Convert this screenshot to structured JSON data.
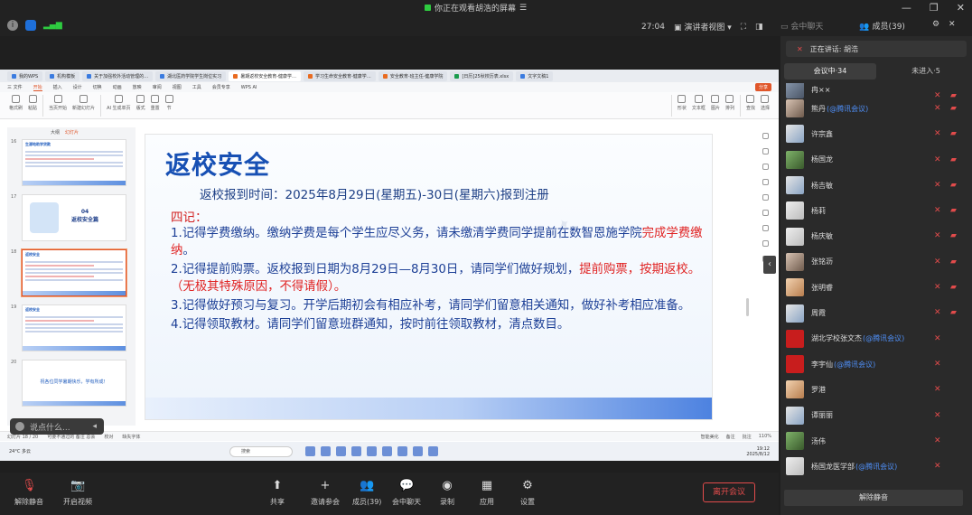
{
  "topbar": {
    "sharing_text": "你正在观看胡浩的屏幕",
    "timer": "27:04",
    "view_mode": "演讲者视图",
    "chat_tab": "会中聊天",
    "members_label": "成员(39)"
  },
  "wps": {
    "tabs": [
      {
        "label": "我的WPS",
        "kind": "home"
      },
      {
        "label": "机构模板",
        "kind": "doc"
      },
      {
        "label": "关于加强校外活动管理的…",
        "kind": "doc"
      },
      {
        "label": "湖北医药学院学生岗位实习",
        "kind": "doc"
      },
      {
        "label": "暑期返校安全教育-健康学…",
        "kind": "ppt",
        "active": true
      },
      {
        "label": "学习生命安全教育-健康学…",
        "kind": "ppt"
      },
      {
        "label": "安全教育-班主任-健康学院",
        "kind": "ppt"
      },
      {
        "label": "[日历]25秋校历表.xlsx",
        "kind": "xls"
      },
      {
        "label": "文字文稿1",
        "kind": "doc"
      }
    ],
    "menu": [
      "三 文件",
      "开始",
      "插入",
      "设计",
      "切换",
      "动画",
      "放映",
      "审阅",
      "视图",
      "工具",
      "会员专享",
      "WPS AI"
    ],
    "menu_active": "开始",
    "share_label": "分享",
    "ribbon": [
      "格式刷",
      "粘贴",
      "当页开始",
      "新建幻灯片",
      "AI 生成单页",
      "版式",
      "重置",
      "节",
      "形状",
      "文本框",
      "图片",
      "排列",
      "查找",
      "选择"
    ],
    "thumb_tabs": [
      "大纲",
      "幻灯片"
    ],
    "thumbs": [
      {
        "num": "16",
        "title": "生源地助学贷款"
      },
      {
        "num": "17",
        "title": "04 返校安全篇"
      },
      {
        "num": "18",
        "title": "返校安全"
      },
      {
        "num": "19",
        "title": "返校安全"
      },
      {
        "num": "20",
        "title": "祝各位同学暑期快乐，学有所成！"
      }
    ],
    "thumb_cover_num": "04",
    "thumb_cover_text": "返校安全篇",
    "status": {
      "slide_pos": "幻灯片 18 / 20",
      "theme": "可要不通过的 备注 总会",
      "proof": "校对",
      "font_missing": "缺失字体",
      "smart": "智能美化",
      "notes": "备注",
      "comments": "批注",
      "zoom": "110%"
    },
    "taskbar": {
      "weather": "24°C 多云",
      "search": "搜索",
      "time": "19:12",
      "date": "2025/8/12"
    }
  },
  "slide": {
    "title": "返校安全",
    "subtitle": "返校报到时间：2025年8月29日(星期五)-30日(星期六)报到注册",
    "heading": "四记：",
    "items": [
      {
        "pre": "1.记得学费缴纳。缴纳学费是每个学生应尽义务，请未缴清学费同学提前在数智恩施学院",
        "red": "完成学费缴纳",
        "post": "。",
        "red2": ""
      },
      {
        "pre": "2.记得提前购票。返校报到日期为8月29日—8月30日，请同学们做好规划，",
        "red": "提前购票，按期返校。（无极其特殊原因，不得请假）",
        "post": "。",
        "red2": ""
      },
      {
        "pre": "3.记得做好预习与复习。开学后期初会有相应补考，请同学们留意相关通知，做好补考相应准备。",
        "red": "",
        "post": "",
        "red2": ""
      },
      {
        "pre": "4.记得领取教材。请同学们留意班群通知，按时前往领取教材，清点数目。",
        "red": "",
        "post": "",
        "red2": ""
      }
    ]
  },
  "comment_placeholder": "说点什么...",
  "panel": {
    "speaking_label": "正在讲话: 胡浩",
    "tab_in_meeting": "会议中·34",
    "tab_not_joined": "未进入·5",
    "participants": [
      {
        "name": "冉××",
        "tag": ""
      },
      {
        "name": "熊丹",
        "tag": "(@腾讯会议)"
      },
      {
        "name": "许宗鑫",
        "tag": ""
      },
      {
        "name": "杨国龙",
        "tag": ""
      },
      {
        "name": "杨吉敏",
        "tag": ""
      },
      {
        "name": "杨莉",
        "tag": ""
      },
      {
        "name": "杨庆敏",
        "tag": ""
      },
      {
        "name": "张铭沥",
        "tag": ""
      },
      {
        "name": "张明睿",
        "tag": ""
      },
      {
        "name": "周霞",
        "tag": ""
      },
      {
        "name": "湖北学校张文杰",
        "tag": "(@腾讯会议)"
      },
      {
        "name": "李宇仙",
        "tag": "(@腾讯会议)"
      },
      {
        "name": "罗港",
        "tag": ""
      },
      {
        "name": "谭丽丽",
        "tag": ""
      },
      {
        "name": "汤伟",
        "tag": ""
      },
      {
        "name": "杨国龙医学部",
        "tag": "(@腾讯会议)"
      }
    ],
    "unmute_all": "解除静音"
  },
  "bottombar": {
    "unmute": "解除静音",
    "start_video": "开启视频",
    "share": "共享",
    "invite": "邀请参会",
    "members": "成员(39)",
    "chat": "会中聊天",
    "record": "录制",
    "apps": "应用",
    "settings": "设置",
    "leave": "离开会议"
  }
}
